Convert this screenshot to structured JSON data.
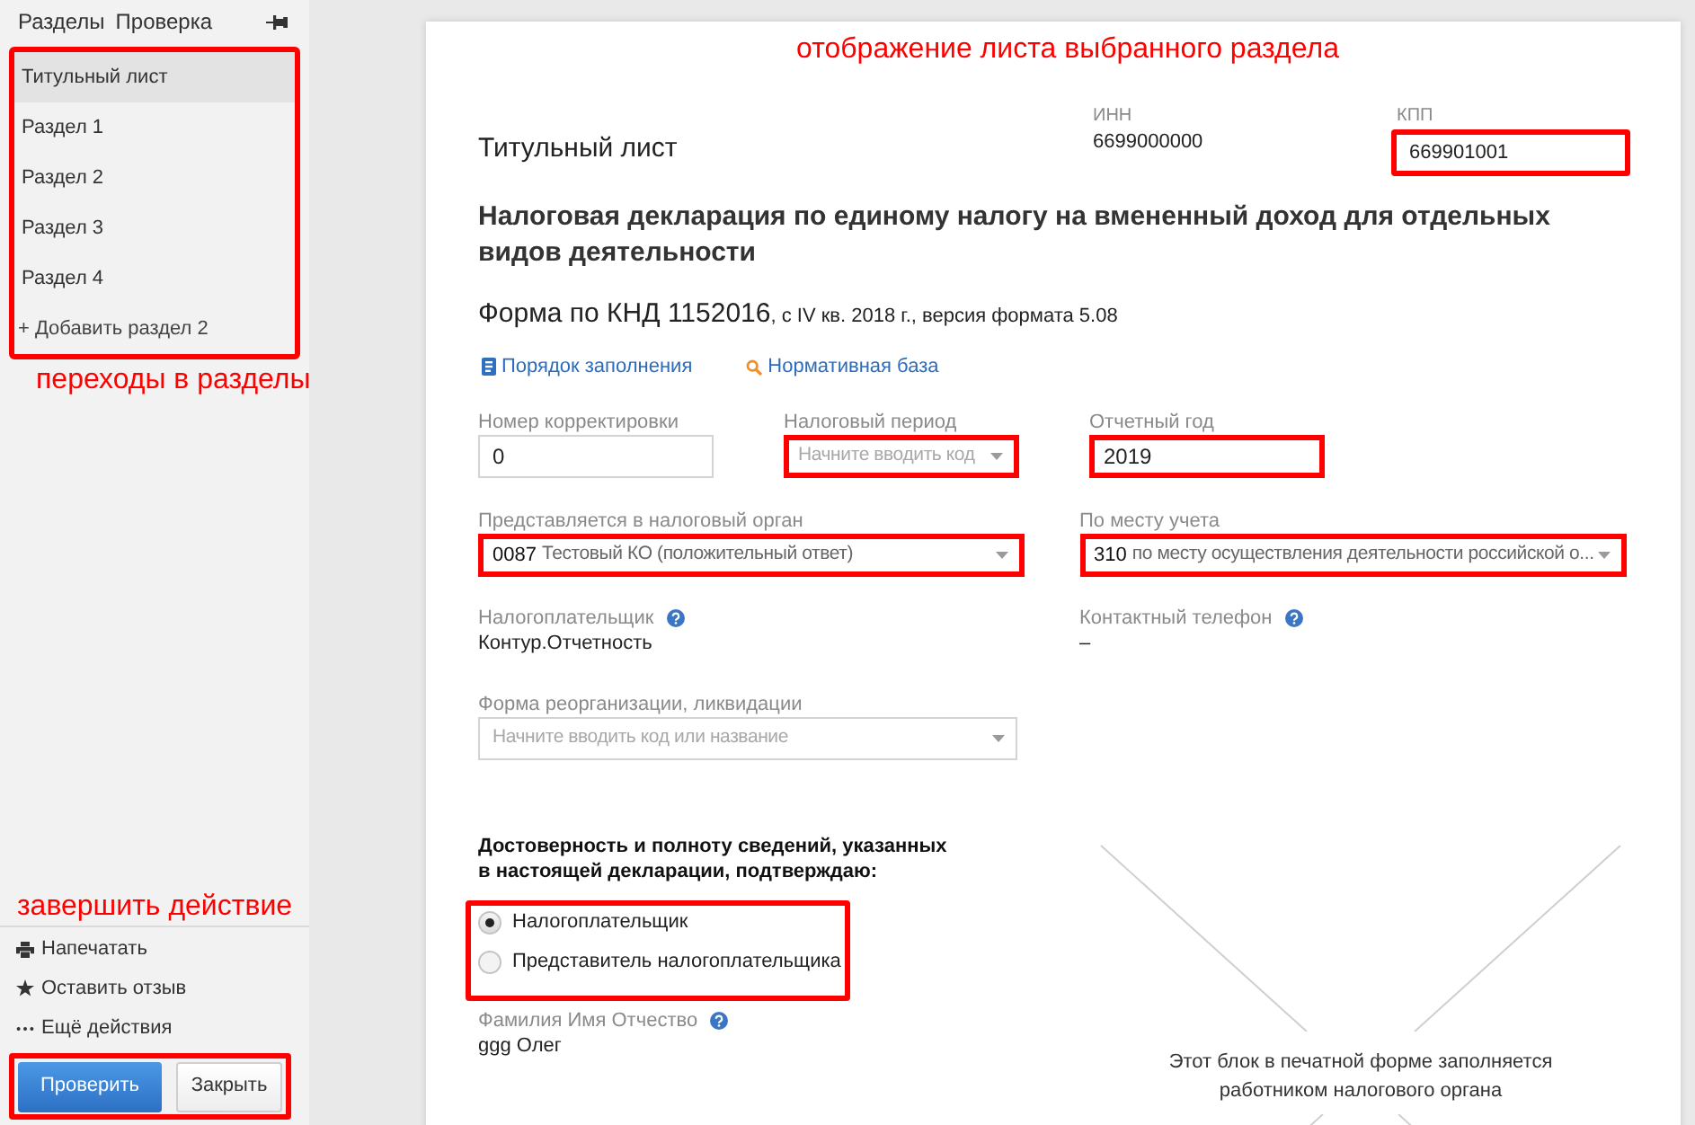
{
  "sidebar": {
    "tabs": [
      "Разделы",
      "Проверка"
    ],
    "sections": {
      "highlighted": true,
      "items": [
        {
          "label": "Титульный лист",
          "selected": true
        },
        {
          "label": "Раздел 1",
          "selected": false
        },
        {
          "label": "Раздел 2",
          "selected": false
        },
        {
          "label": "Раздел 3",
          "selected": false
        },
        {
          "label": "Раздел 4",
          "selected": false
        }
      ],
      "add_item": "+ Добавить раздел 2"
    },
    "sections_note": "переходы в разделы",
    "actions_note": "завершить действие",
    "actions": [
      "Напечатать",
      "Оставить отзыв",
      "Ещё действия"
    ],
    "buttons": {
      "highlighted": true,
      "items": [
        {
          "label": "Проверить",
          "kind": "primary"
        },
        {
          "label": "Закрыть",
          "kind": "secondary"
        }
      ]
    }
  },
  "document": {
    "note": "отображение листа выбранного раздела",
    "sheet_title": "Титульный лист",
    "inn": {
      "label": "ИНН",
      "value": "6699000000"
    },
    "kpp": {
      "label": "КПП",
      "value": "669901001",
      "highlighted": true
    },
    "heading": "Налоговая декларация по единому налогу на вмененный доход для отдельных видов деятельности",
    "form_code": "Форма по КНД 1152016",
    "form_version": ", с IV кв. 2018 г., версия формата 5.08",
    "links": [
      "Порядок заполнения",
      "Нормативная база"
    ],
    "field_rows": [
      [
        {
          "kind": "input",
          "label": "Номер корректировки",
          "value": "0",
          "highlighted": false,
          "help": false
        },
        {
          "kind": "dropdown",
          "label": "Налоговый период",
          "placeholder": "Начните вводить код",
          "highlighted": true,
          "help": false
        },
        {
          "kind": "input",
          "label": "Отчетный год",
          "value": "2019",
          "highlighted": true,
          "help": false
        }
      ],
      [
        {
          "kind": "dropdown",
          "label": "Представляется в налоговый орган",
          "code": "0087",
          "value": "Тестовый КО (положительный ответ)",
          "highlighted": true,
          "help": false
        },
        {
          "kind": "dropdown",
          "label": "По месту учета",
          "code": "310",
          "value": "по месту осуществления деятельности российской о...",
          "highlighted": true,
          "help": false
        }
      ],
      [
        {
          "kind": "text",
          "label": "Налогоплательщик",
          "help": true,
          "value": "Контур.Отчетность"
        },
        {
          "kind": "text",
          "label": "Контактный телефон",
          "help": true,
          "value": "–"
        }
      ],
      [
        {
          "kind": "dropdown",
          "label": "Форма реорганизации, ликвидации",
          "placeholder": "Начните вводить код или название",
          "highlighted": false,
          "help": false
        }
      ]
    ],
    "confirmation": {
      "text": "Достоверность и полноту сведений, указанных в настоящей декларации, подтверждаю:",
      "highlighted": true,
      "options": [
        {
          "label": "Налогоплательщик",
          "selected": true
        },
        {
          "label": "Представитель налогоплательщика",
          "selected": false
        }
      ]
    },
    "signer": {
      "label": "Фамилия Имя Отчество",
      "help": true,
      "value": "ggg Олег"
    },
    "tax_office_note": "Этот блок в печатной форме заполняется работником налогового органа"
  }
}
